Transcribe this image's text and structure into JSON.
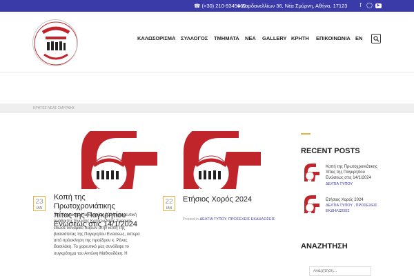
{
  "topbar": {
    "phone": "(+30) 210-9345660",
    "address": "Δαρδανελλίων 36, Νέα Σμύρνη, Αθήνα, 17123",
    "social": [
      "facebook-icon",
      "instagram-icon",
      "youtube-icon"
    ]
  },
  "nav": {
    "items": [
      "ΚΑΛΩΣΟΡΙΣΜΑ",
      "ΣΥΛΛΟΓΟΣ",
      "ΤΜΗΜΑΤΑ",
      "ΝΕΑ",
      "GALLERY",
      "ΚΡΗΤΗ",
      "ΕΠΙΚΟΙΝΩΝΙΑ",
      "EN"
    ]
  },
  "breadcrumb": "ΚΡΗΤΕΣ ΝΕΑΣ ΣΜΥΡΝΗΣ",
  "posts": [
    {
      "day": "23",
      "month": "ΙΑΝ",
      "title_lines": [
        "Κοπή της",
        "Πρωτοχρονιάτικης",
        "πίτας της Παγκρητίου",
        "Ενώσεως στις 14/1/2024"
      ],
      "excerpt_lines": [
        "Την Κυριακή 14 Ιανουαρίου 2024 η χορευτική",
        "ομάδα της Ένωσης Κρητών Νέας Σμύρνης",
        "έδωσε δυναμικό παρών στην κοπή της",
        "βασιλόπιτας της Παγκρητίου Ενώσεως, ύστερα",
        "από πρόσκληση της προέδρου κ. Ρένας",
        "Βασιλάκη. Το χορευτικό μας συνόδεψε το",
        "συγκρότημα του Αντώνη Μαθιουδάκη. Η"
      ]
    },
    {
      "day": "22",
      "month": "ΙΑΝ",
      "title": "Ετήσιος Χορός 2024",
      "meta_prefix": "Posted in",
      "meta_cat1": "ΔΕΛΤΙΑ ΤΥΠΟΥ",
      "meta_sep": ", ",
      "meta_cat2": "ΠΡΟΣΕΧΕΙΣ ΕΚΔΗΛΩΣΕΙΣ"
    }
  ],
  "sidebar": {
    "recent_heading": "RECENT POSTS",
    "recent": [
      {
        "title_lines": [
          "Κοπή της Πρωτοχρονιάτικης",
          "πίτας της Παγκρητίου",
          "Ενώσεως στις 14/1/2024"
        ],
        "cat_lines": [
          "ΔΕΛΤΙΑ ΤΥΠΟΥ"
        ]
      },
      {
        "title_lines": [
          "Ετήσιος Χορός 2024"
        ],
        "cat_lines": [
          "ΔΕΛΤΙΑ ΤΥΠΟΥ , ΠΡΟΣΕΧΕΙΣ",
          "ΕΚΔΗΛΩΣΕΙΣ"
        ]
      }
    ],
    "search_heading": "ΑΝΑΖΗΤΗΣΗ",
    "search_placeholder": "Αναζήτηση..."
  },
  "colors": {
    "topbar": "#3a3aa8",
    "accent": "#e8b33a",
    "brand_red": "#c0252b",
    "link": "#3a3aa8"
  }
}
